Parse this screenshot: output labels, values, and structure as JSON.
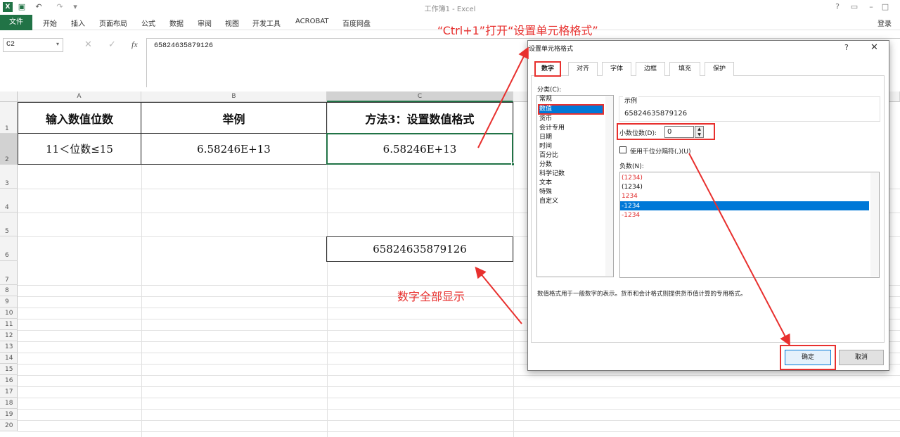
{
  "window": {
    "title": "工作簿1 - Excel",
    "login": "登录",
    "help_icon": "?"
  },
  "ribbon": {
    "tabs": [
      "文件",
      "开始",
      "插入",
      "页面布局",
      "公式",
      "数据",
      "审阅",
      "视图",
      "开发工具",
      "ACROBAT",
      "百度网盘"
    ]
  },
  "formula_bar": {
    "name_box": "C2",
    "fx": "fx",
    "value": "65824635879126"
  },
  "columns": [
    "A",
    "B",
    "C"
  ],
  "rows": [
    "1",
    "2",
    "3",
    "4",
    "5",
    "6",
    "7",
    "8",
    "9",
    "10",
    "11",
    "12",
    "13",
    "14",
    "15",
    "16",
    "17",
    "18",
    "19",
    "20"
  ],
  "table": {
    "headers": [
      "输入数值位数",
      "举例",
      "方法3：设置数值格式"
    ],
    "row2": [
      "11＜位数≤15",
      "6.58246E+13",
      "6.58246E+13"
    ],
    "c6": "65824635879126"
  },
  "annotations": {
    "shortcut": "“Ctrl+1”打开“设置单元格格式”",
    "result": "数字全部显示"
  },
  "dialog": {
    "title": "设置单元格格式",
    "help": "?",
    "close": "✕",
    "tabs": [
      "数字",
      "对齐",
      "字体",
      "边框",
      "填充",
      "保护"
    ],
    "category_label": "分类(C):",
    "categories": [
      "常规",
      "数值",
      "货币",
      "会计专用",
      "日期",
      "时间",
      "百分比",
      "分数",
      "科学记数",
      "文本",
      "特殊",
      "自定义"
    ],
    "selected_category": "数值",
    "sample_label": "示例",
    "sample_value": "65824635879126",
    "decimal_label": "小数位数(D):",
    "decimal_value": "0",
    "thousands_label": "使用千位分隔符(,)(U)",
    "negative_label": "负数(N):",
    "negatives": [
      "(1234)",
      "(1234)",
      "1234",
      "-1234",
      "-1234"
    ],
    "description": "数值格式用于一般数字的表示。货币和会计格式则提供货币值计算的专用格式。",
    "ok": "确定",
    "cancel": "取消"
  },
  "colors": {
    "excel_green": "#217346",
    "highlight_red": "#e8302e",
    "selection_blue": "#0078d7",
    "negative_red": "#e03030"
  }
}
